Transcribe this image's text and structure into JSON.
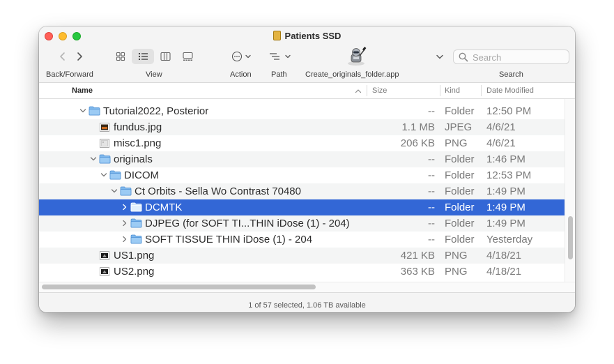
{
  "window": {
    "title": "Patients SSD",
    "title_icon": "external-drive-icon"
  },
  "toolbar": {
    "back_forward_label": "Back/Forward",
    "view_label": "View",
    "action_label": "Action",
    "path_label": "Path",
    "app_label": "Create_originals_folder.app",
    "search_label": "Search",
    "view_mode_selected": "list"
  },
  "search": {
    "placeholder": "Search",
    "value": ""
  },
  "columns": {
    "name": "Name",
    "size": "Size",
    "kind": "Kind",
    "date": "Date Modified"
  },
  "rows": [
    {
      "name": "Tutorial2022, Posterior",
      "size": "--",
      "kind": "Folder",
      "date": "12:50 PM"
    },
    {
      "name": "fundus.jpg",
      "size": "1.1 MB",
      "kind": "JPEG",
      "date": "4/6/21"
    },
    {
      "name": "misc1.png",
      "size": "206 KB",
      "kind": "PNG",
      "date": "4/6/21"
    },
    {
      "name": "originals",
      "size": "--",
      "kind": "Folder",
      "date": "1:46 PM"
    },
    {
      "name": "DICOM",
      "size": "--",
      "kind": "Folder",
      "date": "12:53 PM"
    },
    {
      "name": "Ct Orbits - Sella Wo Contrast 70480",
      "size": "--",
      "kind": "Folder",
      "date": "1:49 PM"
    },
    {
      "name": "DCMTK",
      "size": "--",
      "kind": "Folder",
      "date": "1:49 PM",
      "selected": true
    },
    {
      "name": "DJPEG (for SOFT TI...THIN iDose (1) - 204)",
      "size": "--",
      "kind": "Folder",
      "date": "1:49 PM"
    },
    {
      "name": "SOFT TISSUE THIN iDose (1) - 204",
      "size": "--",
      "kind": "Folder",
      "date": "Yesterday"
    },
    {
      "name": "US1.png",
      "size": "421 KB",
      "kind": "PNG",
      "date": "4/18/21"
    },
    {
      "name": "US2.png",
      "size": "363 KB",
      "kind": "PNG",
      "date": "4/18/21"
    }
  ],
  "status": {
    "text": "1 of 57 selected, 1.06 TB available"
  },
  "colors": {
    "selection": "#3367d6",
    "folder": "#7fb8ec",
    "close": "#ff5f57",
    "minimize": "#febc2e",
    "zoom": "#28c840"
  }
}
